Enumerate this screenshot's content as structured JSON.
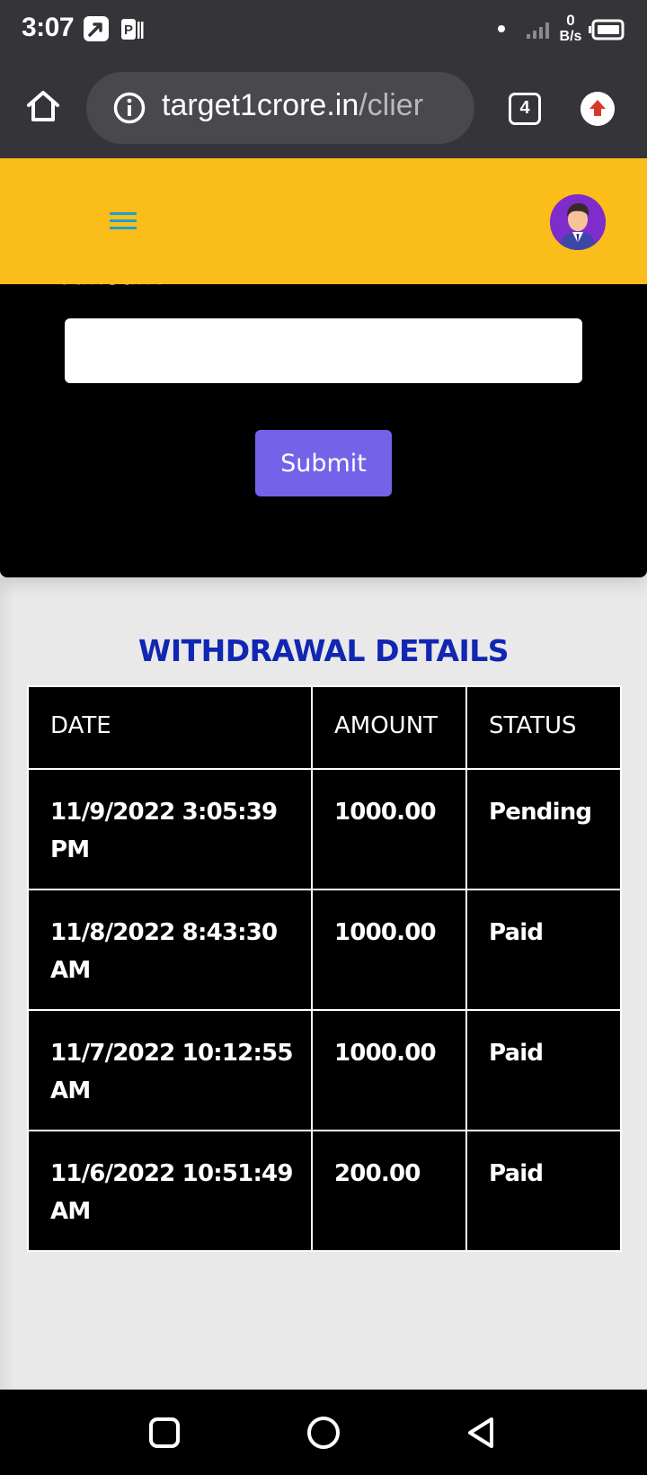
{
  "status_bar": {
    "time": "3:07",
    "net_speed_value": "0",
    "net_speed_unit": "B/s",
    "icons": [
      "screen-share-icon",
      "parking-app-icon",
      "dot-icon",
      "signal-icon",
      "battery-icon"
    ]
  },
  "browser": {
    "url_domain": "target1crore.in",
    "url_path": "/clier",
    "tab_count": "4",
    "icons": [
      "home-icon",
      "info-icon",
      "tab-switcher-icon",
      "update-arrow-icon"
    ]
  },
  "header": {
    "icons": [
      "hamburger-menu-icon",
      "user-avatar-icon"
    ],
    "accent_color": "#fbbd19"
  },
  "form": {
    "amount_label": "Amount",
    "amount_value": "",
    "submit_label": "Submit",
    "submit_color": "#7462e8"
  },
  "withdrawals": {
    "title": "WITHDRAWAL DETAILS",
    "title_color": "#1126b2",
    "columns": [
      "DATE",
      "AMOUNT",
      "STATUS"
    ],
    "rows": [
      {
        "date": "11/9/2022 3:05:39 PM",
        "amount": "1000.00",
        "status": "Pending"
      },
      {
        "date": "11/8/2022 8:43:30 AM",
        "amount": "1000.00",
        "status": "Paid"
      },
      {
        "date": "11/7/2022 10:12:55 AM",
        "amount": "1000.00",
        "status": "Paid"
      },
      {
        "date": "11/6/2022 10:51:49 AM",
        "amount": "200.00",
        "status": "Paid"
      }
    ]
  },
  "nav_bar": {
    "icons": [
      "recents-square-icon",
      "home-circle-icon",
      "back-triangle-icon"
    ]
  }
}
